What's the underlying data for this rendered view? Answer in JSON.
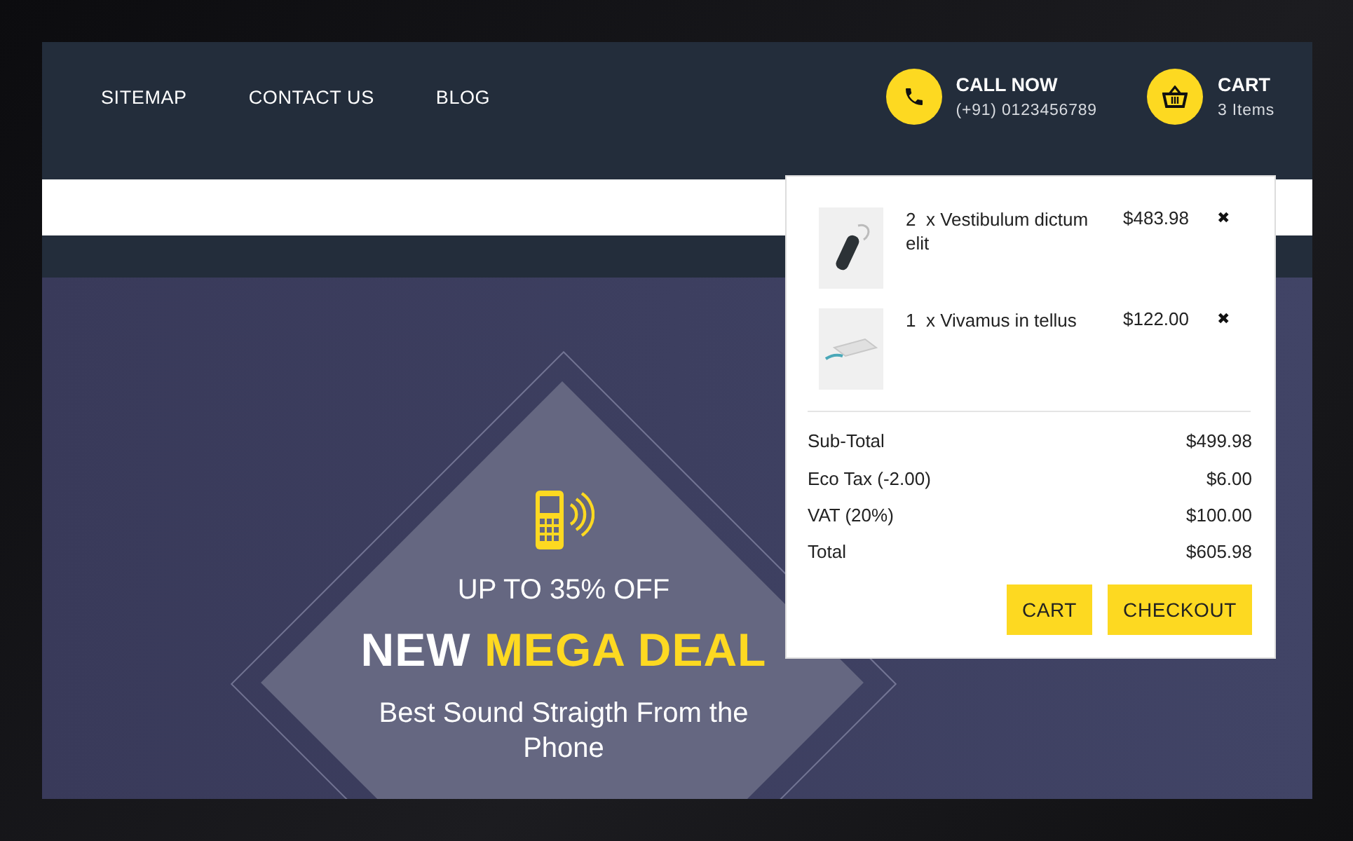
{
  "nav": [
    {
      "label": "SITEMAP"
    },
    {
      "label": "CONTACT US"
    },
    {
      "label": "BLOG"
    }
  ],
  "contact": {
    "title": "CALL NOW",
    "phone": "(+91) 0123456789"
  },
  "cart": {
    "title": "CART",
    "count": "3 Items"
  },
  "hero": {
    "kicker": "UP TO 35% OFF",
    "headline": "NEW",
    "headline_highlight": "MEGA DEAL",
    "subtitle": "Best Sound Straigth From the Phone"
  },
  "cart_dropdown": {
    "items": [
      {
        "qty": "2",
        "name": "x Vestibulum dictum elit",
        "price": "$483.98",
        "remove": "✖",
        "kind": "headset"
      },
      {
        "qty": "1",
        "name": "x Vivamus in tellus",
        "price": "$122.00",
        "remove": "✖",
        "kind": "powerbank"
      }
    ],
    "totals": [
      {
        "label": "Sub-Total",
        "value": "$499.98"
      },
      {
        "label": "Eco Tax (-2.00)",
        "value": "$6.00"
      },
      {
        "label": "VAT (20%)",
        "value": "$100.00"
      },
      {
        "label": "Total",
        "value": "$605.98"
      }
    ],
    "buttons": [
      "CART",
      "CHECKOUT"
    ]
  }
}
